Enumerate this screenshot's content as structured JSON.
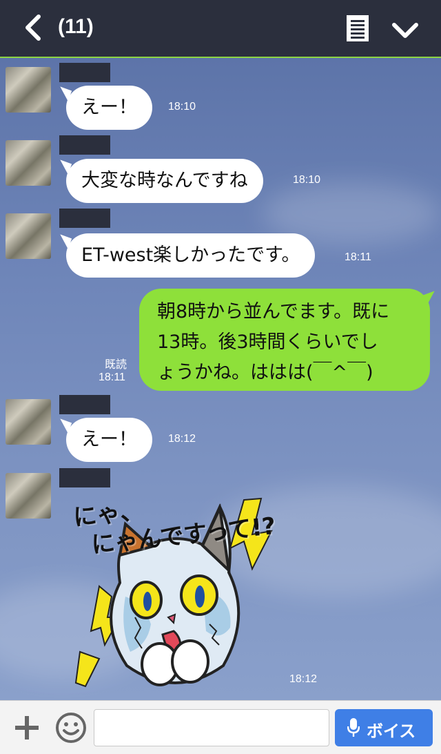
{
  "header": {
    "title": "(11)",
    "back_icon": "chevron-left-icon",
    "memo_icon": "notes-icon",
    "menu_icon": "chevron-down-icon"
  },
  "messages": [
    {
      "text": "えー！",
      "time": "18:10"
    },
    {
      "text": "大変な時なんですね",
      "time": "18:10"
    },
    {
      "text": "ET-west楽しかったです。",
      "time": "18:11"
    },
    {
      "lines": [
        "朝8時から並んでます。既に",
        "13時。後3時間くらいでし",
        "ょうかね。ははは(￣^￣)"
      ],
      "read": "既読",
      "time": "18:11"
    },
    {
      "text": "えー！",
      "time": "18:12"
    },
    {
      "sticker_caption": [
        "にゃ、",
        "にゃんですって!?"
      ],
      "time": "18:12"
    }
  ],
  "footer": {
    "plus_icon": "plus-icon",
    "emoji_icon": "smiley-icon",
    "input_placeholder": "",
    "voice_label": "ボイス",
    "voice_icon": "microphone-icon"
  },
  "colors": {
    "header_bg": "#2b2f3d",
    "outgoing_bubble": "#8ee03a",
    "incoming_bubble": "#ffffff",
    "voice_button": "#3f7fe6"
  }
}
